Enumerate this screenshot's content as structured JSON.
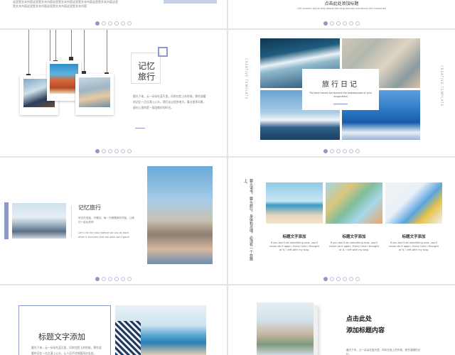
{
  "slide1": {
    "text": "这里是文本内容这里是文本内容这里是文本内容这里是文本内容这里是文本内容这里是文本内容这里是文本内容这里是文本内容这里是文本内容"
  },
  "slide2": {
    "title": "点击此处添加标题",
    "subtitle": "Life should not be only about the long journey but about the memories"
  },
  "slide3": {
    "heading_line1": "记忆",
    "heading_line2": "旅行",
    "body": "晨光下来，云一朵朵在蓝天里，风吹在脸上的时候，那些温暖的记忆一点点涌上心头。我们走过很多地方，看过很多风景，留在心里的是一段段美好的时光。"
  },
  "slide4": {
    "title": "旅行日记",
    "subtitle": "The best travels are beyond the kaleidoscope of your imagination",
    "side_left": "CREATIVE TEMPLATE",
    "side_right": "CREATIVE TEMPLATE"
  },
  "slide5": {
    "title": "记忆旅行",
    "body_cn": "时光在流逝，不要怕，每一天都是新的开始，让我们一起出发吧",
    "body_en": "Let's hit the road before we say at each other's funerals that we wish we'd gone"
  },
  "slide6": {
    "vertical_text": "要么读书，要么旅行，身体和灵魂，必须有一个在路上。",
    "cards": [
      {
        "title": "标题文字添加",
        "text": "If you don't do something now, you'll never do it again. Every time I thought of it, I left with my bag."
      },
      {
        "title": "标题文字添加",
        "text": "If you don't do something now, you'll never do it again. Every time I thought of it, I left with my bag."
      },
      {
        "title": "标题文字添加",
        "text": "If you don't do something now, you'll never do it again. Every time I thought of it, I left with my bag."
      }
    ]
  },
  "slide7": {
    "title": "标题文字添加",
    "body": "晨光下来，云一朵朵在蓝天里，风吹在脸上的时候，那些温暖的记忆一点点涌上心头，让人忍不住想要再次出发。"
  },
  "slide8": {
    "title_line1": "点击此处",
    "title_line2": "添加标题内容",
    "body": "晨光下来，云一朵朵在蓝天里，风吹在脸上的时候，那些温暖的记忆。"
  },
  "pagination": {
    "total": 6,
    "active": 1
  },
  "colors": {
    "accent": "#8c99c9",
    "accent_light": "#c7cfe8",
    "text": "#333333"
  }
}
